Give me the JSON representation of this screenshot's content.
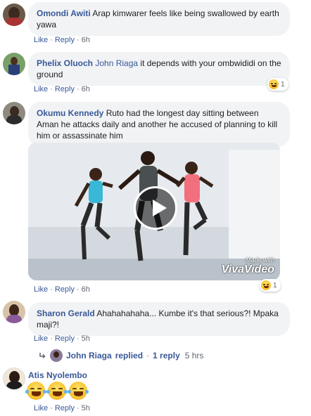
{
  "comments": [
    {
      "author": "Omondi Awiti",
      "text": "Arap kimwarer feels like being swallowed by earth yawa",
      "like": "Like",
      "reply": "Reply",
      "time": "6h"
    },
    {
      "author": "Phelix Oluoch",
      "tag": "John Riaga",
      "text": "it depends with your ombwididi on the ground",
      "like": "Like",
      "reply": "Reply",
      "time": "6h",
      "reaction_count": "1"
    },
    {
      "author": "Okumu Kennedy",
      "text": "Ruto had the longest day sitting between Aman he attacks daily and another he accused of planning to kill him or assassinate him",
      "like": "Like",
      "reply": "Reply",
      "time": "6h",
      "reaction_count": "1",
      "video_watermark_small": "Made with",
      "video_watermark": "VivaVideo"
    },
    {
      "author": "Sharon Gerald",
      "text": "Ahahahahaha... Kumbe it's that serious?! Mpaka maji?!",
      "like": "Like",
      "reply": "Reply",
      "time": "5h"
    },
    {
      "author": "Atis Nyolembo",
      "like": "Like",
      "reply": "Reply",
      "time": "5h"
    }
  ],
  "replies_link": {
    "name": "John Riaga",
    "verb": "replied",
    "count": "1 reply",
    "time": "5 hrs"
  },
  "separator": "·",
  "reaction_icon": "laughing-emoji",
  "colors": {
    "link": "#385898",
    "bubble": "#f2f3f5",
    "meta": "#606770"
  }
}
